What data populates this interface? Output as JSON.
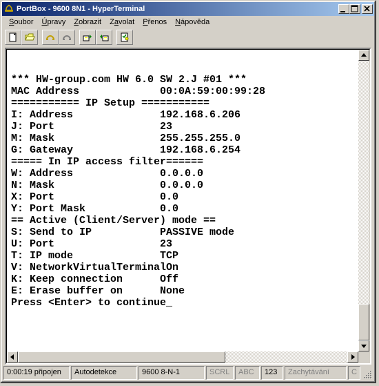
{
  "title": "PortBox - 9600 8N1 - HyperTerminal",
  "menu": {
    "soubor": "Soubor",
    "upravy": "Úpravy",
    "zobrazit": "Zobrazit",
    "zavolat": "Zavolat",
    "prenos": "Přenos",
    "napoveda": "Nápověda"
  },
  "toolbar": {
    "icons": [
      "new-file-icon",
      "open-file-icon",
      "phone-connect-icon",
      "phone-disconnect-icon",
      "send-icon",
      "receive-icon",
      "properties-icon"
    ]
  },
  "terminal": {
    "lines": [
      "*** HW-group.com HW 6.0 SW 2.J #01 ***",
      "MAC Address          00:0A:59:00:99:28",
      "=========== IP Setup ===========",
      "I: Address              192.168.6.206",
      "J: Port                 23",
      "M: Mask                 255.255.255.0",
      "G: Gateway              192.168.6.254",
      "===== In IP access filter  ======",
      "W: Address              0.0.0.0",
      "N: Mask                 0.0.0.0",
      "X: Port                 0.0",
      "Y: Port Mask            0.0",
      "== Active (Client/Server) mode ==",
      "S: Send to IP           PASSIVE mode",
      "U: Port                 23",
      "T: IP mode              TCP",
      "V: NetworkVirtualTerminal  On",
      "K: Keep connection      Off",
      "E: Erase buffer on      None",
      "Press <Enter> to continue_"
    ]
  },
  "status": {
    "time": "0:00:19 připojen",
    "detect": "Autodetekce",
    "settings": "9600 8-N-1",
    "scrl": "SCRL",
    "abc": "ABC",
    "num": "123",
    "capture": "Zachytávání",
    "last": "C"
  }
}
